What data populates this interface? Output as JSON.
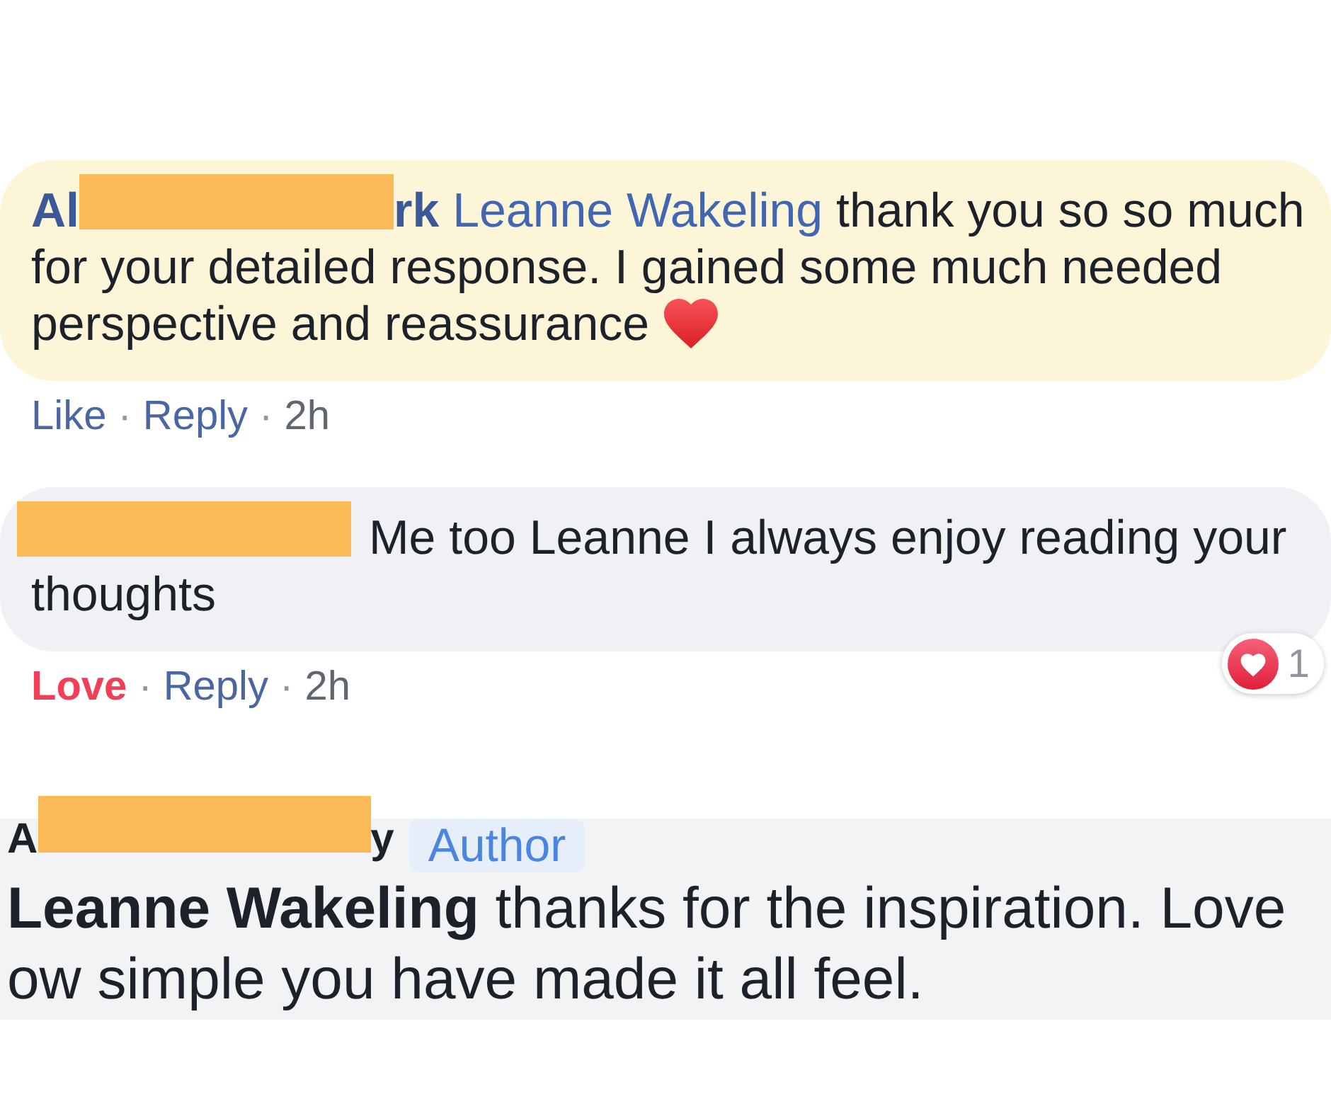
{
  "comments": [
    {
      "kind": "bubble",
      "highlighted": true,
      "author": {
        "visible_start": "Al",
        "redacted": true,
        "visible_end": "rk"
      },
      "mention": "Leanne Wakeling",
      "text": "thank you so so much for your detailed response. I gained some much needed perspective and reassurance",
      "heart_emoji": true,
      "actions": {
        "reaction": {
          "label": "Like",
          "active": false
        },
        "separator": "·",
        "reply": "Reply",
        "time": "2h"
      }
    },
    {
      "kind": "bubble",
      "highlighted": false,
      "author": {
        "redacted": true
      },
      "text": "Me too Leanne I always enjoy reading your thoughts",
      "reactions": {
        "count": "1"
      },
      "actions": {
        "reaction": {
          "label": "Love",
          "active": true
        },
        "separator": "·",
        "reply": "Reply",
        "time": "2h"
      }
    },
    {
      "kind": "mobile",
      "author": {
        "visible_start": "A",
        "redacted": true,
        "visible_end": "y"
      },
      "badge": "Author",
      "text": "**Leanne Wakeling** thanks for the inspiration. Love ow simple you have made it all feel."
    }
  ]
}
